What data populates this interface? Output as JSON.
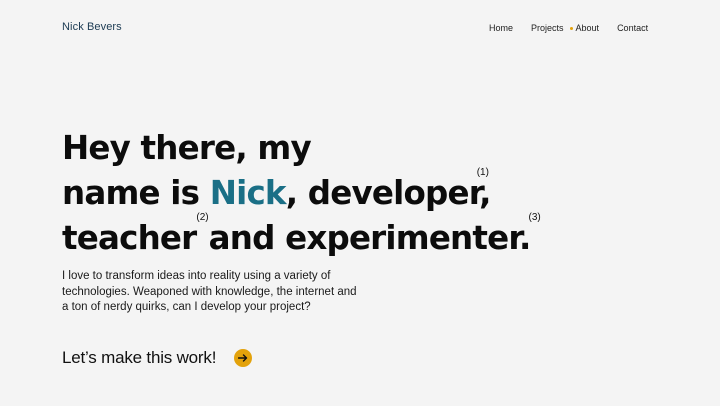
{
  "header": {
    "brand": "Nick Bevers",
    "nav": [
      {
        "label": "Home"
      },
      {
        "label": "Projects"
      },
      {
        "label": "About",
        "active": true
      },
      {
        "label": "Contact"
      }
    ]
  },
  "hero": {
    "line1": "Hey there, my",
    "line2_prefix": "name is ",
    "line2_name": "Nick",
    "line2_suffix": ", developer,",
    "line3_a": "teacher",
    "line3_b": "and experimenter.",
    "footnotes": [
      "(1)",
      "(2)",
      "(3)"
    ],
    "intro": "I love to transform ideas into reality using a variety of technologies. Weaponed with knowledge, the internet and a ton of nerdy quirks, can I develop your project?",
    "cta_label": "Let’s make this work!",
    "cta_icon": "arrow-right-icon"
  },
  "colors": {
    "background": "#f4f4f4",
    "accent": "#1a6f86",
    "highlight": "#e3a20b",
    "text": "#0c0c0c"
  }
}
